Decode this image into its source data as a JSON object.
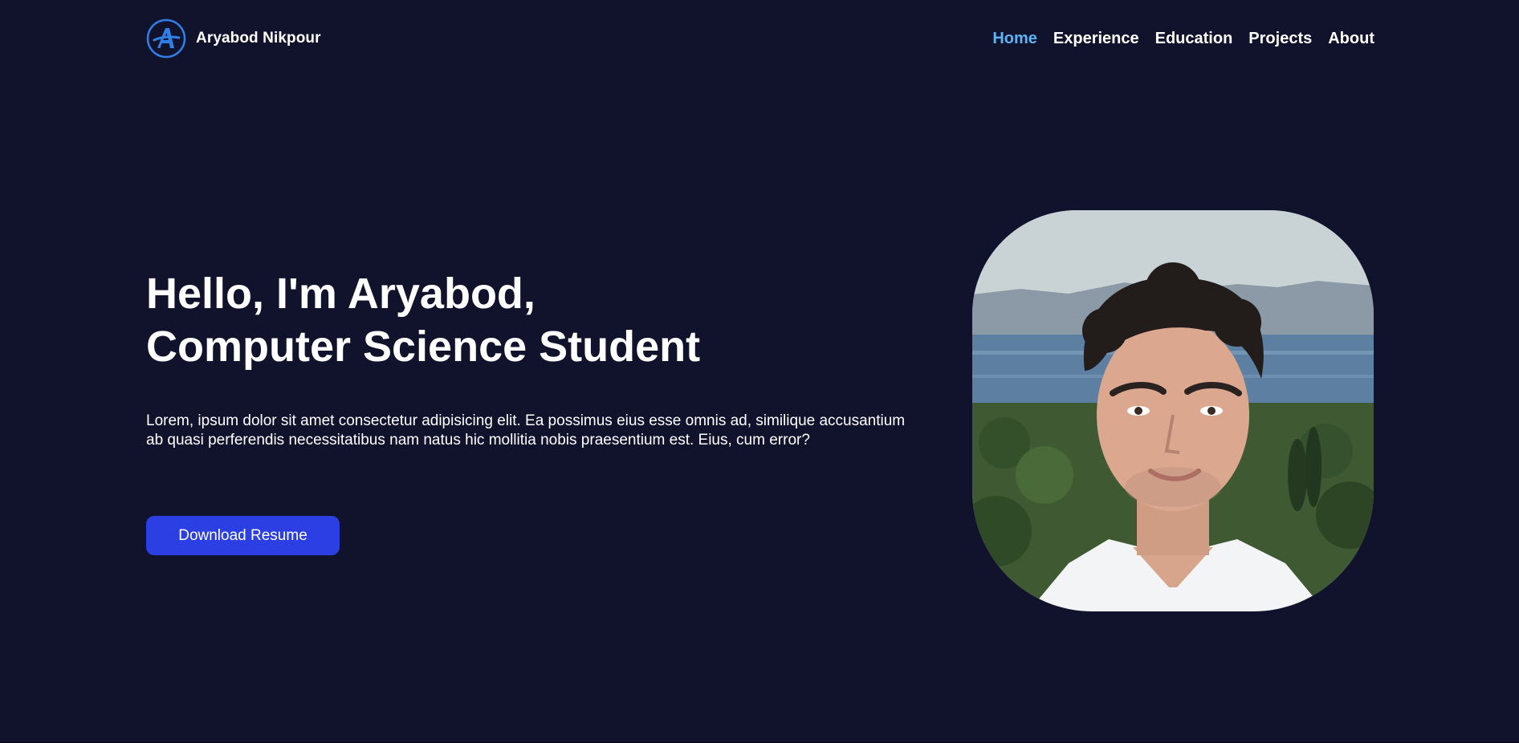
{
  "brand": {
    "name": "Aryabod Nikpour",
    "logo_icon": "letter-a-circle-icon"
  },
  "nav": {
    "items": [
      {
        "label": "Home",
        "active": true
      },
      {
        "label": "Experience",
        "active": false
      },
      {
        "label": "Education",
        "active": false
      },
      {
        "label": "Projects",
        "active": false
      },
      {
        "label": "About",
        "active": false
      }
    ]
  },
  "hero": {
    "title_line1": "Hello, I'm Aryabod,",
    "title_line2": "Computer Science Student",
    "description": "Lorem, ipsum dolor sit amet consectetur adipisicing elit. Ea possimus eius esse omnis ad, similique accusantium ab quasi perferendis necessitatibus nam natus hic mollitia nobis praesentium est. Eius, cum error?",
    "cta_label": "Download Resume"
  },
  "colors": {
    "background": "#11122c",
    "accent_nav": "#5eb4f3",
    "button": "#2b3fe3",
    "logo": "#2f7fe6"
  }
}
